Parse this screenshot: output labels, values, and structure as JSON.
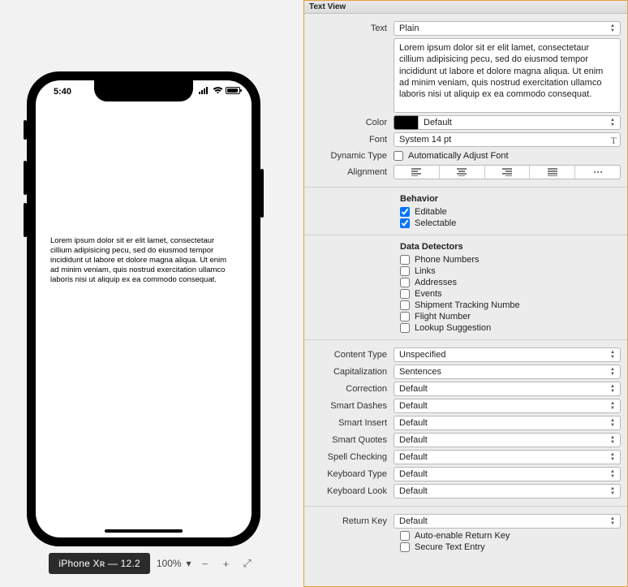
{
  "simulator": {
    "time": "5:40",
    "lorem": "Lorem ipsum dolor sit er elit lamet, consectetaur cillium adipisicing pecu, sed do eiusmod tempor incididunt ut labore et dolore magna aliqua. Ut enim ad minim veniam, quis nostrud exercitation ullamco laboris nisi ut aliquip ex ea commodo consequat.",
    "device_label": "iPhone Xʀ — 12.2",
    "zoom": "100%"
  },
  "panel": {
    "title": "Text View",
    "text_label": "Text",
    "text_mode": "Plain",
    "text_value": "Lorem ipsum dolor sit er elit lamet, consectetaur cillium adipisicing pecu, sed do eiusmod tempor incididunt ut labore et dolore magna aliqua. Ut enim ad minim veniam, quis nostrud exercitation ullamco laboris nisi ut aliquip ex ea commodo consequat.",
    "color_label": "Color",
    "color_value": "Default",
    "font_label": "Font",
    "font_value": "System 14 pt",
    "dyn_label": "Dynamic Type",
    "dyn_check": "Automatically Adjust Font",
    "align_label": "Alignment",
    "behavior_title": "Behavior",
    "editable": "Editable",
    "selectable": "Selectable",
    "detectors_title": "Data Detectors",
    "detectors": [
      "Phone Numbers",
      "Links",
      "Addresses",
      "Events",
      "Shipment Tracking Numbe",
      "Flight Number",
      "Lookup Suggestion"
    ],
    "content_type_label": "Content Type",
    "content_type": "Unspecified",
    "capitalization_label": "Capitalization",
    "capitalization": "Sentences",
    "correction_label": "Correction",
    "correction": "Default",
    "smart_dashes_label": "Smart Dashes",
    "smart_dashes": "Default",
    "smart_insert_label": "Smart Insert",
    "smart_insert": "Default",
    "smart_quotes_label": "Smart Quotes",
    "smart_quotes": "Default",
    "spell_label": "Spell Checking",
    "spell": "Default",
    "kbd_type_label": "Keyboard Type",
    "kbd_type": "Default",
    "kbd_look_label": "Keyboard Look",
    "kbd_look": "Default",
    "return_label": "Return Key",
    "return_key": "Default",
    "auto_enable": "Auto-enable Return Key",
    "secure": "Secure Text Entry"
  }
}
